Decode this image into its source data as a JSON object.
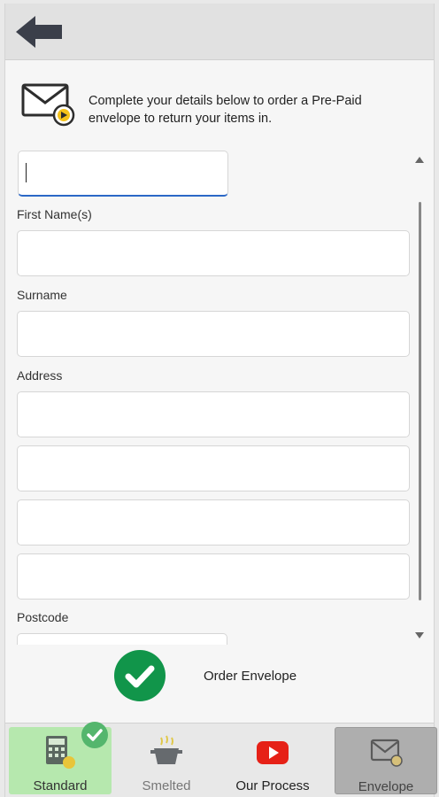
{
  "header": {
    "back_icon": "back-arrow-icon"
  },
  "intro": {
    "icon": "envelope-arrow-icon",
    "text": "Complete your details below to order a Pre-Paid envelope to return your items in."
  },
  "form": {
    "title_field": {
      "value": "",
      "placeholder": ""
    },
    "first_name": {
      "label": "First Name(s)",
      "value": ""
    },
    "surname": {
      "label": "Surname",
      "value": ""
    },
    "address": {
      "label": "Address",
      "lines": [
        "",
        "",
        "",
        ""
      ]
    },
    "postcode": {
      "label": "Postcode",
      "value": ""
    }
  },
  "order": {
    "icon": "check-circle-icon",
    "label": "Order Envelope",
    "color": "#11954a"
  },
  "tabs": [
    {
      "label": "Standard",
      "icon": "calculator-coins-icon",
      "selected_badge": true,
      "color": "#b6e8ae"
    },
    {
      "label": "Smelted",
      "icon": "smelting-pot-icon"
    },
    {
      "label": "Our Process",
      "icon": "youtube-play-icon",
      "color": "#e62117"
    },
    {
      "label": "Envelope",
      "icon": "envelope-icon",
      "active": true
    }
  ]
}
